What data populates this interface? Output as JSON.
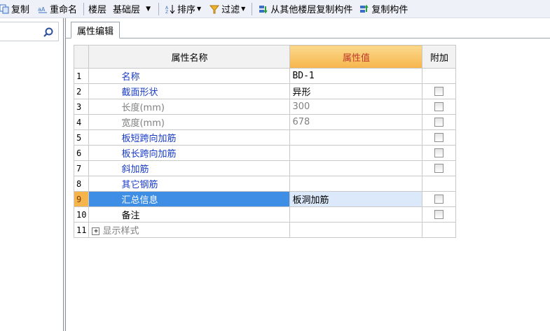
{
  "toolbar": {
    "copy_label": "复制",
    "rename_label": "重命名",
    "floor_label": "楼层",
    "floor_value": "基础层",
    "sort_label": "排序",
    "filter_label": "过滤",
    "copy_from_floor_label": "从其他楼层复制构件",
    "copy_component_label": "复制构件"
  },
  "search": {
    "placeholder": ""
  },
  "tab": {
    "label": "属性编辑"
  },
  "grid": {
    "headers": {
      "name": "属性名称",
      "value": "属性值",
      "extra": "附加"
    },
    "rows": [
      {
        "num": "1",
        "name": "名称",
        "value": "BD-1",
        "style": "blue",
        "has_check": false
      },
      {
        "num": "2",
        "name": "截面形状",
        "value": "异形",
        "style": "blue",
        "has_check": true
      },
      {
        "num": "3",
        "name": "长度(mm)",
        "value": "300",
        "style": "gray",
        "has_check": true
      },
      {
        "num": "4",
        "name": "宽度(mm)",
        "value": "678",
        "style": "gray",
        "has_check": true
      },
      {
        "num": "5",
        "name": "板短跨向加筋",
        "value": "",
        "style": "blue",
        "has_check": true
      },
      {
        "num": "6",
        "name": "板长跨向加筋",
        "value": "",
        "style": "blue",
        "has_check": true
      },
      {
        "num": "7",
        "name": "斜加筋",
        "value": "",
        "style": "blue",
        "has_check": true
      },
      {
        "num": "8",
        "name": "其它钢筋",
        "value": "",
        "style": "blue",
        "has_check": false
      },
      {
        "num": "9",
        "name": "汇总信息",
        "value": "板洞加筋",
        "style": "blue",
        "has_check": true,
        "selected": true
      },
      {
        "num": "10",
        "name": "备注",
        "value": "",
        "style": "black",
        "has_check": true
      },
      {
        "num": "11",
        "name": "显示样式",
        "value": "",
        "style": "gray",
        "has_check": false,
        "expandable": true
      }
    ]
  },
  "colors": {
    "header_value_bg": "#f6b54c",
    "selected_row": "#3f8ee6",
    "link_blue": "#1a3cc8"
  }
}
